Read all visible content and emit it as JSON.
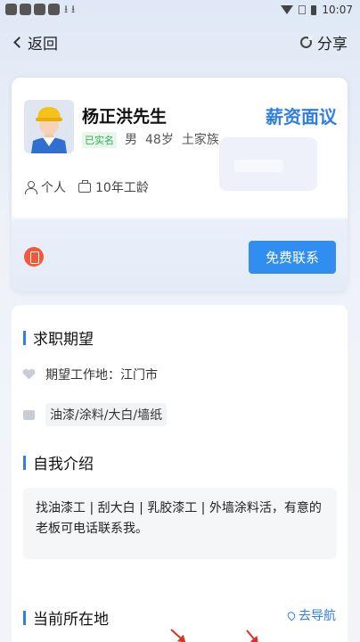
{
  "status_bar": {
    "time": "10:07",
    "download_icons": "⭳ ⭳"
  },
  "nav": {
    "back_label": "返回",
    "share_label": "分享"
  },
  "profile": {
    "name": "杨正洪先生",
    "salary": "薪资面议",
    "verified_badge": "已实名",
    "gender": "男",
    "age": "48岁",
    "ethnicity": "土家族",
    "type": "个人",
    "experience": "10年工龄",
    "contact_button": "免费联系"
  },
  "job_expectation": {
    "title": "求职期望",
    "location": "期望工作地：江门市",
    "skills": "油漆/涂料/大白/墙纸"
  },
  "self_intro": {
    "title": "自我介绍",
    "text": "找油漆工 | 刮大白 | 乳胶漆工 | 外墙涂料活，有意的老板可电话联系我。"
  },
  "current_location": {
    "title": "当前所在地",
    "navigate_label": "去导航"
  },
  "colors": {
    "accent": "#2f7fe3",
    "button": "#2f8ef0",
    "verified": "#2fae4f",
    "phone_badge": "#f05a3a",
    "annotation_arrow": "#e0301e"
  },
  "icons": [
    "back-chevron-icon",
    "share-icon",
    "person-icon",
    "briefcase-icon",
    "phone-icon",
    "heart-icon",
    "navigation-icon"
  ]
}
